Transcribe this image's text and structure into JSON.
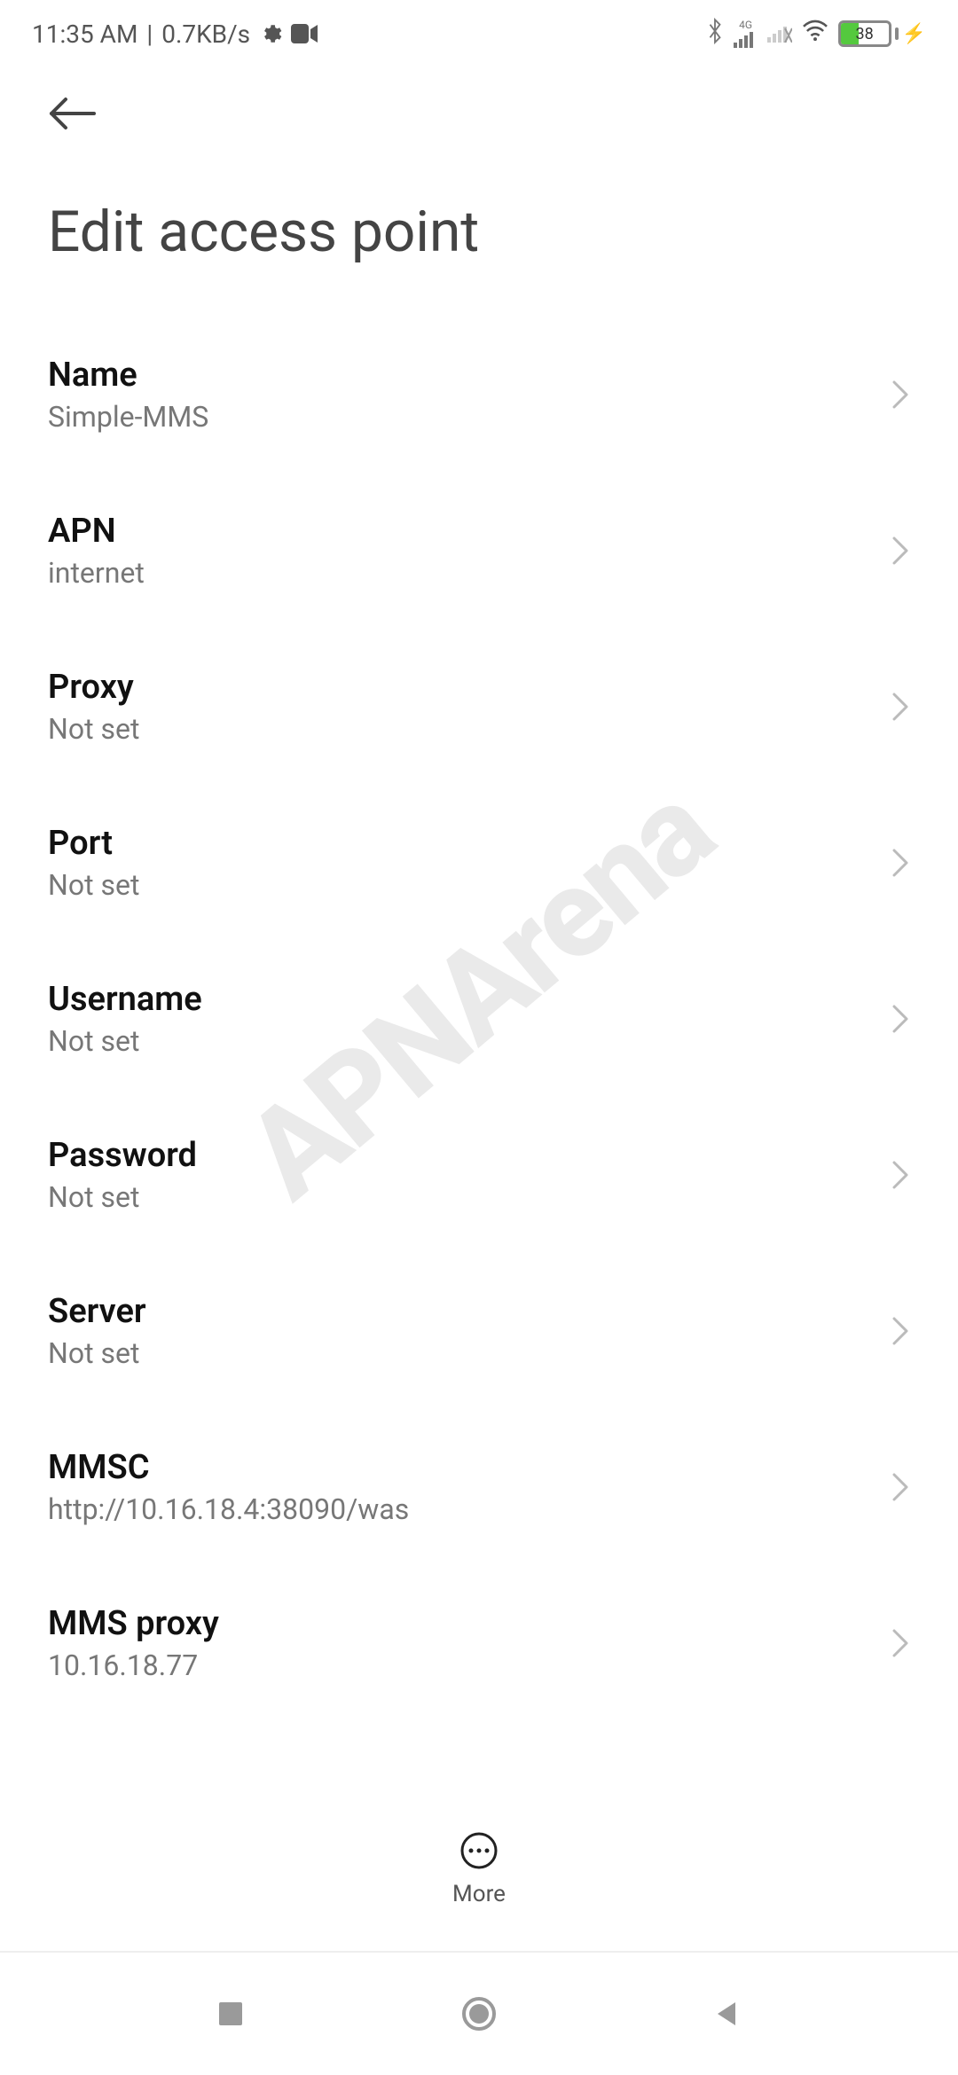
{
  "status_bar": {
    "time": "11:35 AM",
    "separator": "|",
    "net_speed": "0.7KB/s",
    "network_indicator": "4G",
    "battery_percent": "38"
  },
  "header": {
    "title": "Edit access point"
  },
  "settings": [
    {
      "key": "name",
      "title": "Name",
      "value": "Simple-MMS"
    },
    {
      "key": "apn",
      "title": "APN",
      "value": "internet"
    },
    {
      "key": "proxy",
      "title": "Proxy",
      "value": "Not set"
    },
    {
      "key": "port",
      "title": "Port",
      "value": "Not set"
    },
    {
      "key": "username",
      "title": "Username",
      "value": "Not set"
    },
    {
      "key": "password",
      "title": "Password",
      "value": "Not set"
    },
    {
      "key": "server",
      "title": "Server",
      "value": "Not set"
    },
    {
      "key": "mmsc",
      "title": "MMSC",
      "value": "http://10.16.18.4:38090/was"
    },
    {
      "key": "mmsproxy",
      "title": "MMS proxy",
      "value": "10.16.18.77"
    }
  ],
  "footer": {
    "more_label": "More"
  },
  "watermark": "APNArena"
}
